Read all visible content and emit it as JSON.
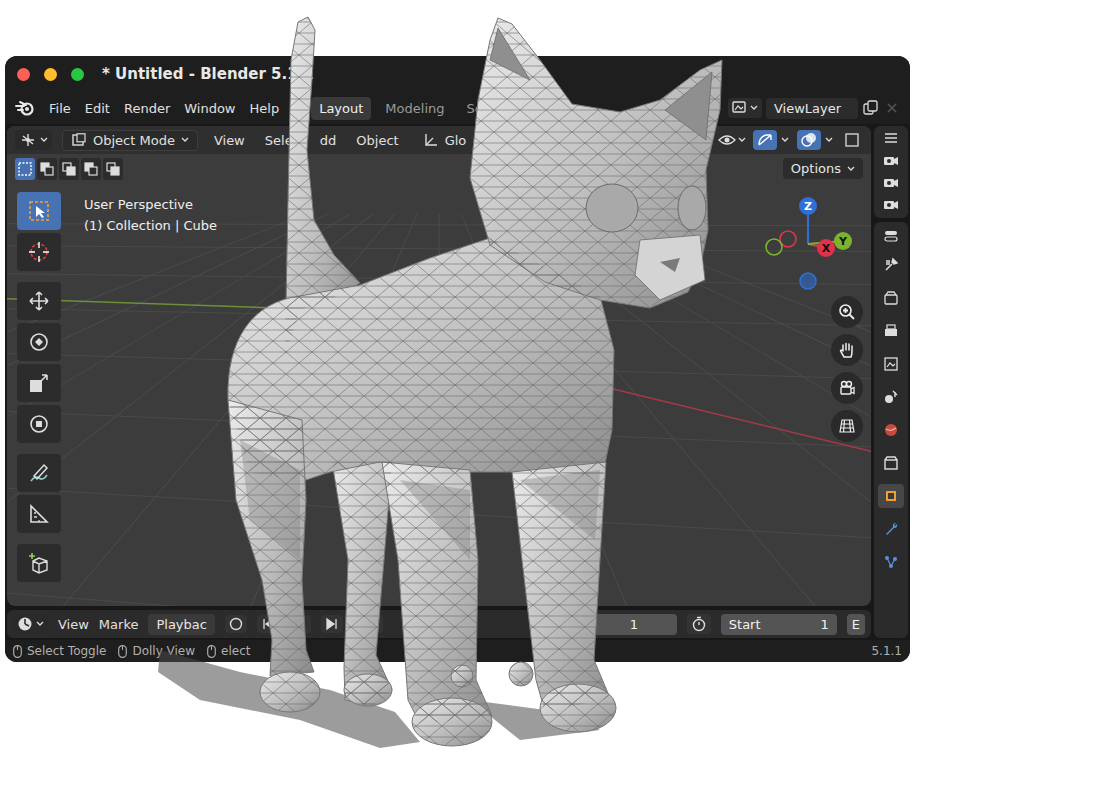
{
  "window": {
    "title": "* Untitled - Blender 5.1.1"
  },
  "menu": [
    "File",
    "Edit",
    "Render",
    "Window",
    "Help"
  ],
  "workspaces": [
    {
      "label": "Layout",
      "selected": true
    },
    {
      "label": "Modeling",
      "selected": false
    },
    {
      "label": "Sc",
      "selected": false
    }
  ],
  "view_layer": "ViewLayer",
  "header": {
    "mode": "Object Mode",
    "menus": [
      "View",
      "Selec",
      "dd",
      "Object"
    ],
    "orientation": "Glo",
    "options": "Options"
  },
  "select_modes": [
    {
      "selected": true
    },
    {
      "selected": false
    },
    {
      "selected": false
    },
    {
      "selected": false
    },
    {
      "selected": false
    }
  ],
  "viewport": {
    "perspective": "User Perspective",
    "collection": "(1) Collection | Cube"
  },
  "tools": [
    {
      "kind": "select",
      "selected": true
    },
    {
      "kind": "cursor",
      "selected": false
    },
    {
      "kind": "move",
      "selected": false
    },
    {
      "kind": "rotate",
      "selected": false
    },
    {
      "kind": "scale",
      "selected": false
    },
    {
      "kind": "transform",
      "selected": false
    },
    {
      "kind": "annotate",
      "selected": false
    },
    {
      "kind": "measure",
      "selected": false
    },
    {
      "kind": "add",
      "selected": false
    }
  ],
  "gizmo": [
    {
      "label": "Z",
      "color": "#2f6fd6"
    },
    {
      "label": "X",
      "color": "#e0334a"
    },
    {
      "label": "Y",
      "color": "#7bb32e"
    }
  ],
  "properties_tabs": [
    {
      "kind": "tool",
      "selected": false
    },
    {
      "kind": "render",
      "selected": false
    },
    {
      "kind": "output",
      "selected": false
    },
    {
      "kind": "view",
      "selected": false
    },
    {
      "kind": "scene",
      "selected": false
    },
    {
      "kind": "world",
      "selected": false
    },
    {
      "kind": "collection",
      "selected": false
    },
    {
      "kind": "object",
      "selected": true
    },
    {
      "kind": "modifier",
      "selected": false
    },
    {
      "kind": "particles",
      "selected": false
    }
  ],
  "timeline": {
    "menus": [
      "View",
      "Marke"
    ],
    "playback": "Playbac",
    "frame": "1",
    "start_label": "Start",
    "start": "1",
    "end_label": "E"
  },
  "status_bar": {
    "hints": [
      "Select Toggle",
      "Dolly View",
      "elect"
    ],
    "version": "5.1.1"
  }
}
